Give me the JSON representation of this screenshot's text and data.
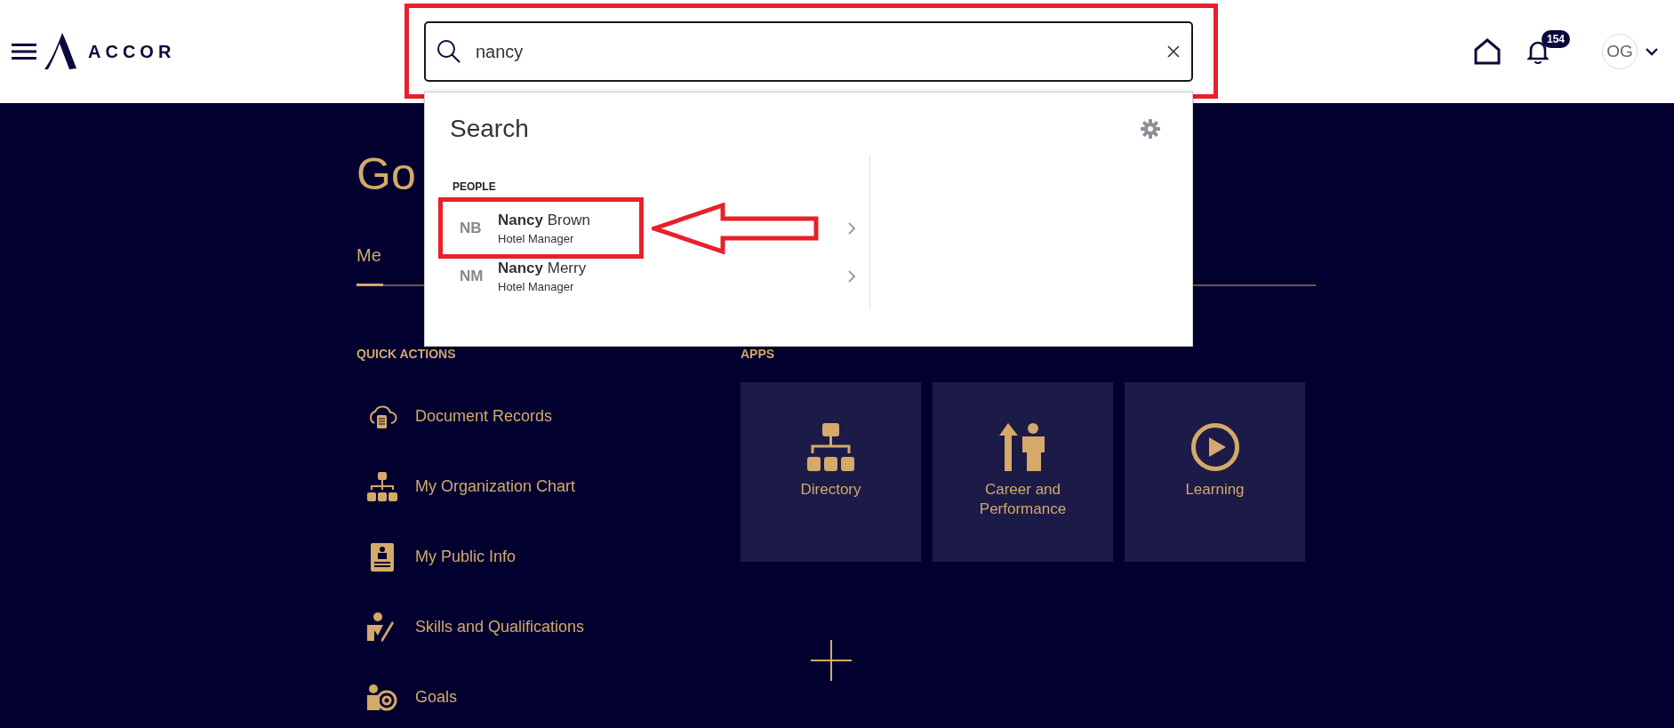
{
  "header": {
    "logo": "ACCOR",
    "notifications": "154",
    "avatar": "OG"
  },
  "search": {
    "value": "nancy",
    "annotated": true
  },
  "search_panel": {
    "title": "Search",
    "section": "PEOPLE",
    "results": [
      {
        "initials": "NB",
        "name": "**Nancy** Brown",
        "title": "Hotel Manager",
        "annotated": true
      },
      {
        "initials": "NM",
        "name": "**Nancy** Merry",
        "title": "Hotel Manager",
        "annotated": false
      }
    ]
  },
  "greeting": "Go",
  "tabs": [
    {
      "label": "Me",
      "selected": true
    }
  ],
  "quick_actions": {
    "title": "QUICK ACTIONS",
    "items": [
      {
        "label": "Document Records"
      },
      {
        "label": "My Organization Chart"
      },
      {
        "label": "My Public Info"
      },
      {
        "label": "Skills and Qualifications"
      },
      {
        "label": "Goals"
      }
    ]
  },
  "apps": {
    "title": "APPS",
    "tiles": [
      {
        "label": "Directory"
      },
      {
        "label": "Career and Performance"
      },
      {
        "label": "Learning"
      }
    ]
  }
}
